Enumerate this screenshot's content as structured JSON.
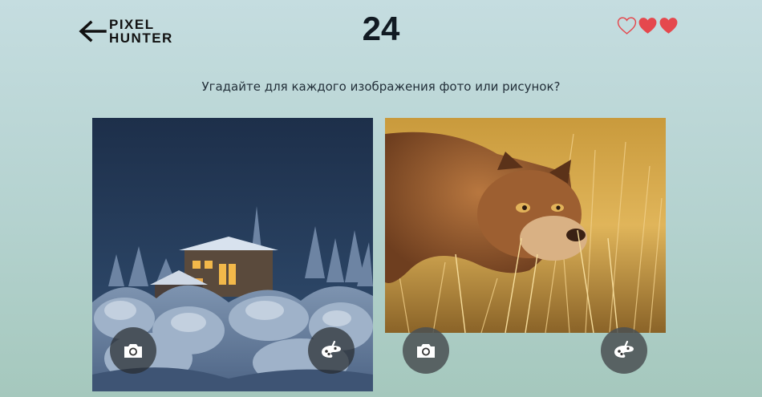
{
  "header": {
    "back_icon": "arrow-left-icon",
    "logo_line1": "PIXEL",
    "logo_line2": "HUNTER",
    "timer": "24",
    "lives": {
      "total": 3,
      "remaining": 2,
      "icon": "heart-icon",
      "color": "#e5484d"
    }
  },
  "question": "Угадайте для каждого изображения фото или рисунок?",
  "options": [
    {
      "image_icon": "snowy-house-image",
      "answers": [
        "camera-icon",
        "palette-icon"
      ]
    },
    {
      "image_icon": "cougar-image",
      "answers": [
        "camera-icon",
        "palette-icon"
      ]
    }
  ],
  "colors": {
    "accent": "#e5484d",
    "text": "#111a22"
  }
}
